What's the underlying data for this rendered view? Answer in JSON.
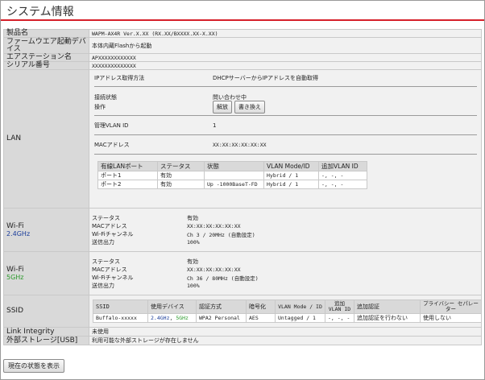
{
  "page_title": "システム情報",
  "product": {
    "label": "製品名",
    "value": "WAPM-AX4R Ver.X.XX (RX.XX/BXXXX.XX-X.XX)"
  },
  "firmware": {
    "label": "ファームウエア起動デバイス",
    "value": "本体内蔵Flashから起動"
  },
  "station": {
    "label": "エアステーション名",
    "value": "APXXXXXXXXXXXX"
  },
  "serial": {
    "label": "シリアル番号",
    "value": "XXXXXXXXXXXXXX"
  },
  "lan": {
    "label": "LAN",
    "ip_method_label": "IPアドレス取得方法",
    "ip_method_value": "DHCPサーバーからIPアドレスを自動取得",
    "conn_label": "接続状態",
    "conn_value": "問い合わせ中",
    "op_label": "操作",
    "release_btn": "解放",
    "rewrite_btn": "書き換え",
    "vlan_label": "管理VLAN ID",
    "vlan_value": "1",
    "mac_label": "MACアドレス",
    "mac_value": "XX:XX:XX:XX:XX:XX",
    "ports": {
      "headers": [
        "有線LANポート",
        "ステータス",
        "状態",
        "VLAN Mode/ID",
        "追加VLAN ID"
      ],
      "rows": [
        [
          "ポート1",
          "有効",
          "",
          "Hybrid / 1",
          "-, -, -"
        ],
        [
          "ポート2",
          "有効",
          "Up -1000BaseT-FD",
          "Hybrid / 1",
          "-, -, -"
        ]
      ]
    }
  },
  "wifi24": {
    "label": "Wi-Fi",
    "band": "2.4GHz",
    "band_color": "#1a3c9a",
    "items": [
      {
        "k": "ステータス",
        "v": "有効"
      },
      {
        "k": "MACアドレス",
        "v": "XX:XX:XX:XX:XX:XX"
      },
      {
        "k": "Wi-Fiチャンネル",
        "v": "Ch 3 / 20MHz (自動設定)"
      },
      {
        "k": "送信出力",
        "v": "100%"
      }
    ]
  },
  "wifi5": {
    "label": "Wi-Fi",
    "band": "5GHz",
    "band_color": "#2a9a2a",
    "items": [
      {
        "k": "ステータス",
        "v": "有効"
      },
      {
        "k": "MACアドレス",
        "v": "XX:XX:XX:XX:XX:XX"
      },
      {
        "k": "Wi-Fiチャンネル",
        "v": "Ch 36 / 80MHz (自動設定)"
      },
      {
        "k": "送信出力",
        "v": "100%"
      }
    ]
  },
  "ssid": {
    "label": "SSID",
    "headers": [
      "SSID",
      "使用デバイス",
      "認証方式",
      "暗号化",
      "VLAN Mode / ID",
      "追加 VLAN ID",
      "追加認証",
      "プライバシー セパレーター"
    ],
    "row": {
      "ssid": "Buffalo-xxxxx",
      "device_a": "2.4GHz",
      "device_sep": ", ",
      "device_b": "5GHz",
      "auth": "WPA2 Personal",
      "enc": "AES",
      "vlan": "Untagged / 1",
      "add_vlan": "-, -, -",
      "add_auth": "追加認証を行わない",
      "privacy": "使用しない"
    }
  },
  "link_integrity": {
    "label": "Link Integrity",
    "value": "未使用"
  },
  "storage": {
    "label": "外部ストレージ[USB]",
    "value": "利用可能な外部ストレージが存在しません"
  },
  "show_status_btn": "現在の状態を表示"
}
